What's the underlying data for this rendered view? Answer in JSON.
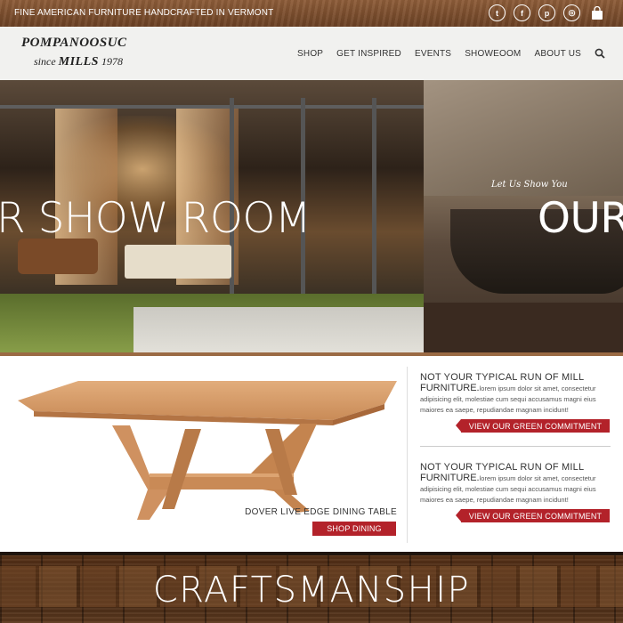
{
  "topbar": {
    "tagline": "FINE AMERICAN FURNITURE HANDCRAFTED IN VERMONT",
    "social": [
      {
        "icon": "twitter-icon",
        "glyph": "t"
      },
      {
        "icon": "facebook-icon",
        "glyph": "f"
      },
      {
        "icon": "pinterest-icon",
        "glyph": "p"
      },
      {
        "icon": "instagram-icon",
        "glyph": "◎"
      }
    ],
    "cart_icon": "shopping-bag-icon"
  },
  "header": {
    "logo_line1": "POMPANOOSUC",
    "logo_since": "since",
    "logo_mills": "MILLS",
    "logo_year": "1978",
    "nav": [
      "SHOP",
      "GET INSPIRED",
      "EVENTS",
      "SHOWEOOM",
      "ABOUT US"
    ],
    "search_icon": "search-icon"
  },
  "hero": {
    "text_left": "R SHOW ROOM",
    "script": "Let Us Show You",
    "text_right": "OUR"
  },
  "product": {
    "caption": "DOVER LIVE EDGE DINING TABLE",
    "button": "SHOP DINING"
  },
  "promos": [
    {
      "title_line1": "NOT YOUR TYPICAL RUN OF MILL",
      "title_line2": "FURNITURE.",
      "body": "lorem ipsum dolor sit amet, consectetur adipisicing elit, molestiae cum sequi accusamus magni eius maiores ea saepe, repudiandae magnam incidunt!",
      "button": "VIEW OUR GREEN COMMITMENT"
    },
    {
      "title_line1": "NOT YOUR TYPICAL RUN OF MILL",
      "title_line2": "FURNITURE.",
      "body": "lorem ipsum dolor sit amet, consectetur adipisicing elit, molestiae cum sequi accusamus magni eius maiores ea saepe, repudiandae magnam incidunt!",
      "button": "VIEW OUR GREEN COMMITMENT"
    }
  ],
  "banner": {
    "title": "CRAFTSMANSHIP"
  },
  "colors": {
    "accent_red": "#b3222a",
    "wood_brown": "#7b4d2a",
    "header_bg": "#f1f1ef"
  }
}
